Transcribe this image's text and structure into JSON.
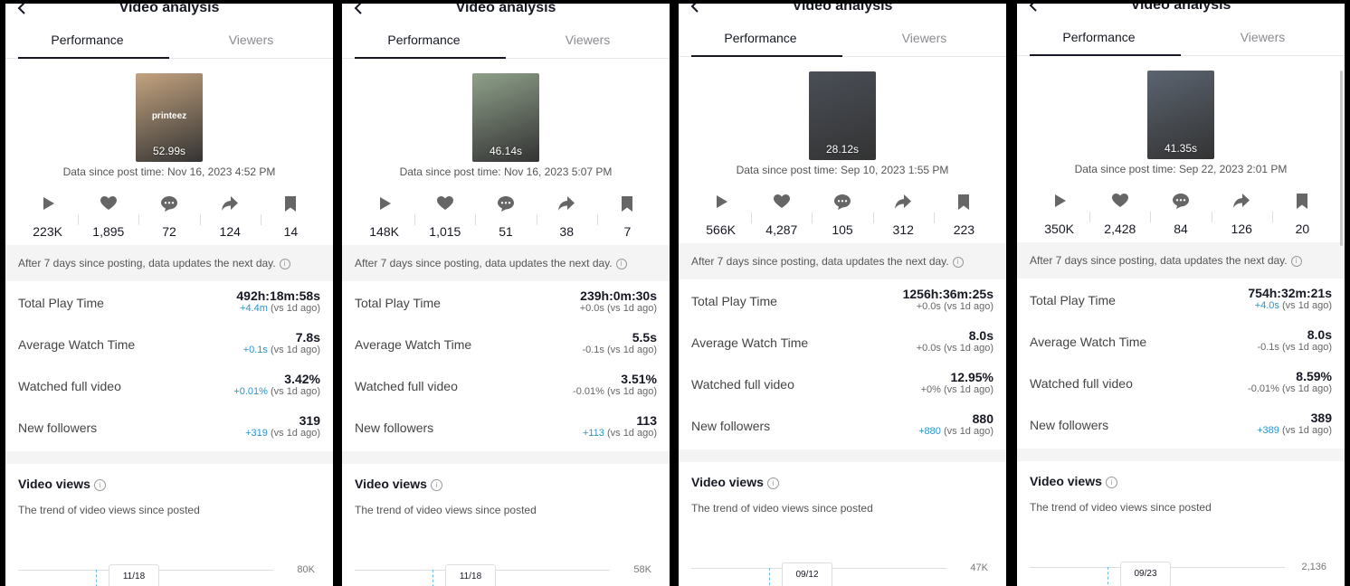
{
  "header_title": "Video analysis",
  "tabs": [
    "Performance",
    "Viewers"
  ],
  "note_text": "After 7 days since posting, data updates the next day.",
  "metric_labels": [
    "Total Play Time",
    "Average Watch Time",
    "Watched full video",
    "New followers"
  ],
  "vs_text": "(vs 1d ago)",
  "video_views_title": "Video views",
  "video_views_sub": "The trend of video views since posted",
  "info_glyph": "i",
  "colors": {
    "accent": "#2a95c9",
    "text": "#161823",
    "muted": "#8a8b91"
  },
  "panels": [
    {
      "thumb": {
        "duration": "52.99s",
        "brand": "printeez",
        "bg": "#c4a37f"
      },
      "since": "Data since post time: Nov 16, 2023 4:52 PM",
      "stats": [
        "223K",
        "1,895",
        "72",
        "124",
        "14"
      ],
      "metrics": [
        {
          "value": "492h:18m:58s",
          "delta": "+4.4m",
          "positive": true
        },
        {
          "value": "7.8s",
          "delta": "+0.1s",
          "positive": true
        },
        {
          "value": "3.42%",
          "delta": "+0.01%",
          "positive": true
        },
        {
          "value": "319",
          "delta": "+319",
          "positive": true
        }
      ],
      "chart": {
        "max": "80K",
        "date": "11/18"
      }
    },
    {
      "thumb": {
        "duration": "46.14s",
        "brand": "",
        "bg": "#8fa08a"
      },
      "since": "Data since post time: Nov 16, 2023 5:07 PM",
      "stats": [
        "148K",
        "1,015",
        "51",
        "38",
        "7"
      ],
      "metrics": [
        {
          "value": "239h:0m:30s",
          "delta": "+0.0s",
          "positive": false
        },
        {
          "value": "5.5s",
          "delta": "-0.1s",
          "positive": false
        },
        {
          "value": "3.51%",
          "delta": "-0.01%",
          "positive": false
        },
        {
          "value": "113",
          "delta": "+113",
          "positive": true
        }
      ],
      "chart": {
        "max": "58K",
        "date": "11/18"
      }
    },
    {
      "thumb": {
        "duration": "28.12s",
        "brand": "",
        "bg": "#4a4f57"
      },
      "since": "Data since post time: Sep 10, 2023 1:55 PM",
      "stats": [
        "566K",
        "4,287",
        "105",
        "312",
        "223"
      ],
      "metrics": [
        {
          "value": "1256h:36m:25s",
          "delta": "+0.0s",
          "positive": false
        },
        {
          "value": "8.0s",
          "delta": "+0.0s",
          "positive": false
        },
        {
          "value": "12.95%",
          "delta": "+0%",
          "positive": false
        },
        {
          "value": "880",
          "delta": "+880",
          "positive": true
        }
      ],
      "chart": {
        "max": "47K",
        "date": "09/12"
      }
    },
    {
      "thumb": {
        "duration": "41.35s",
        "brand": "",
        "bg": "#5b6470"
      },
      "since": "Data since post time: Sep 22, 2023 2:01 PM",
      "stats": [
        "350K",
        "2,428",
        "84",
        "126",
        "20"
      ],
      "metrics": [
        {
          "value": "754h:32m:21s",
          "delta": "+4.0s",
          "positive": true
        },
        {
          "value": "8.0s",
          "delta": "-0.1s",
          "positive": false
        },
        {
          "value": "8.59%",
          "delta": "-0.01%",
          "positive": false
        },
        {
          "value": "389",
          "delta": "+389",
          "positive": true
        }
      ],
      "chart": {
        "max": "2,136",
        "date": "09/23"
      }
    }
  ]
}
